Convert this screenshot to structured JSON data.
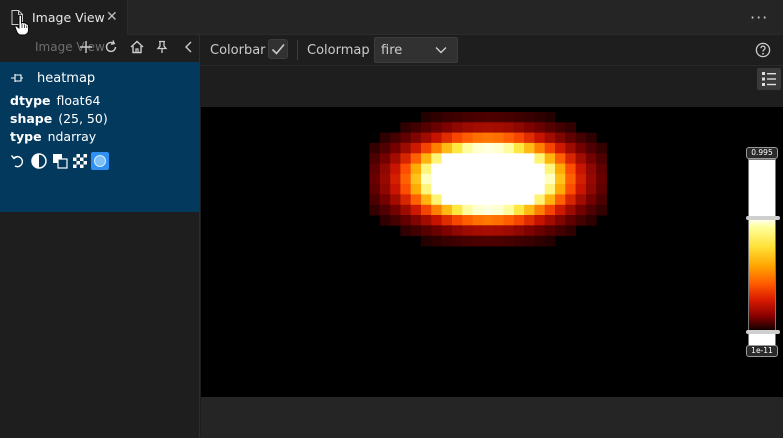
{
  "tab": {
    "title": "Image View",
    "close": "✕"
  },
  "more_menu": "···",
  "left_panel": {
    "title": "Image View",
    "item": {
      "name": "heatmap",
      "props": [
        {
          "key": "dtype",
          "value": "float64"
        },
        {
          "key": "shape",
          "value": "(25, 50)"
        },
        {
          "key": "type",
          "value": "ndarray"
        }
      ]
    }
  },
  "toolbar": {
    "colorbar_label": "Colorbar",
    "colorbar_checked": true,
    "colormap_label": "Colormap",
    "colormap_value": "fire"
  },
  "colorbar": {
    "max_label": "0.995",
    "min_label": "1e-11"
  },
  "colors": {
    "selection": "#04395e",
    "accent": "#2f8ff2"
  }
}
